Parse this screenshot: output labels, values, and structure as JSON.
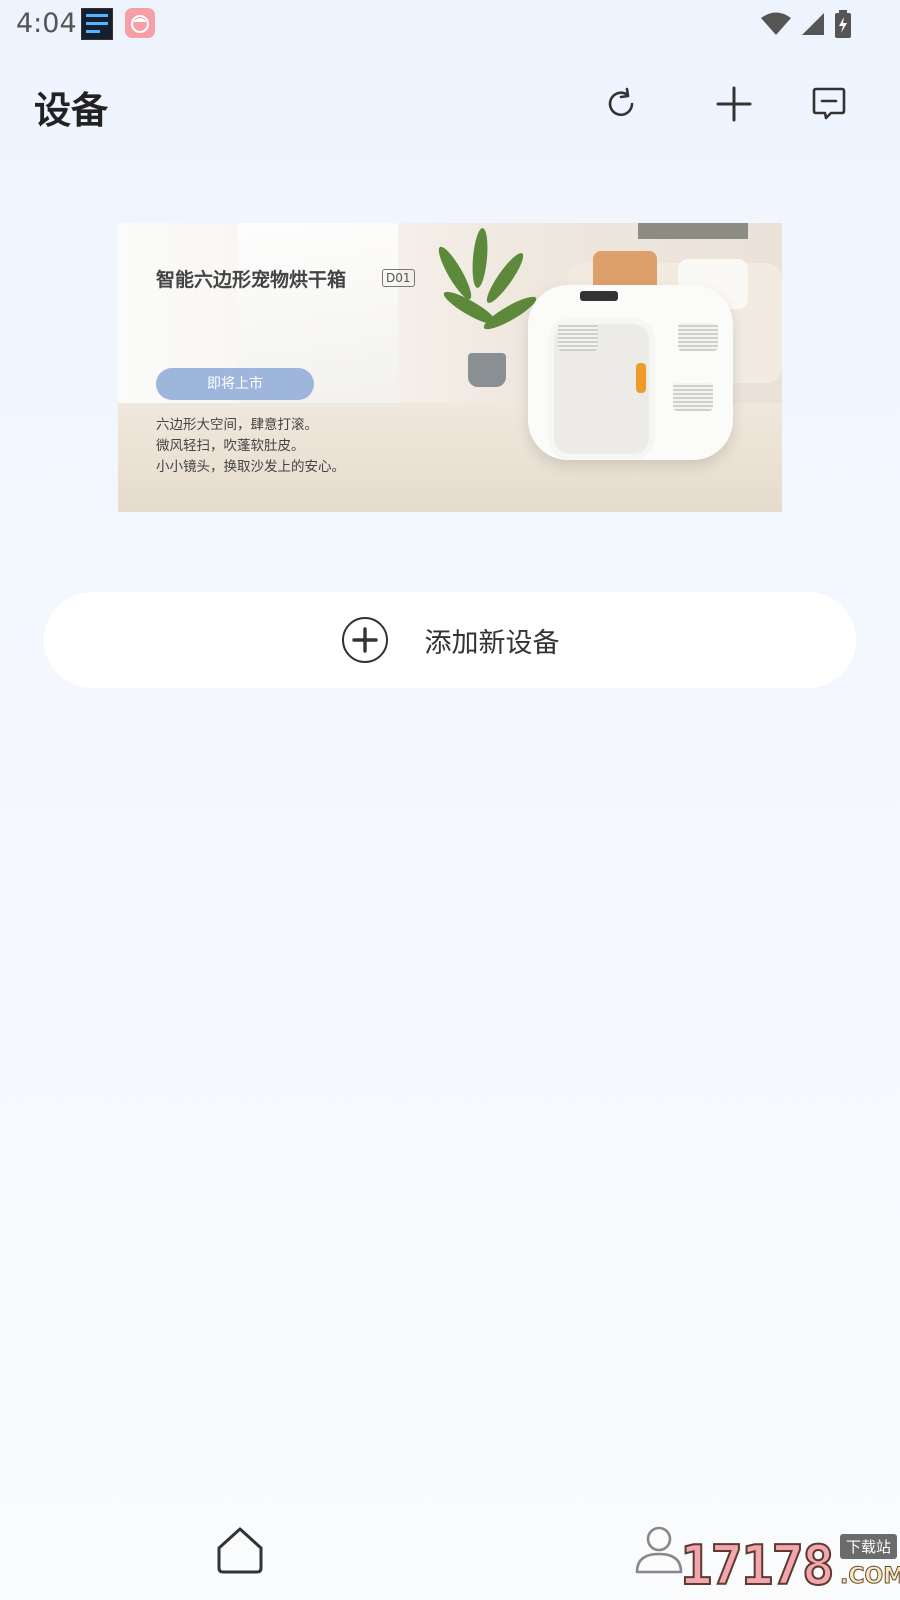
{
  "status_bar": {
    "time": "4:04"
  },
  "header": {
    "title": "设备"
  },
  "banner": {
    "title": "智能六边形宠物烘干箱",
    "model_tag": "D01",
    "button_label": "即将上市",
    "lines": [
      "六边形大空间，肆意打滚。",
      "微风轻扫，吹蓬软肚皮。",
      "小小镜头，换取沙发上的安心。"
    ]
  },
  "add_device": {
    "label": "添加新设备"
  },
  "watermark": {
    "digits": "17178",
    "small": "下载站",
    "domain": ".COM"
  },
  "colors": {
    "accent_button": "#9fb6dc",
    "background_top": "#eef4fe",
    "handle": "#f19a2c"
  },
  "icons": [
    "refresh-icon",
    "add-icon",
    "message-icon",
    "plus-circle-icon",
    "home-icon",
    "user-icon",
    "wifi-icon",
    "signal-icon",
    "battery-icon"
  ]
}
